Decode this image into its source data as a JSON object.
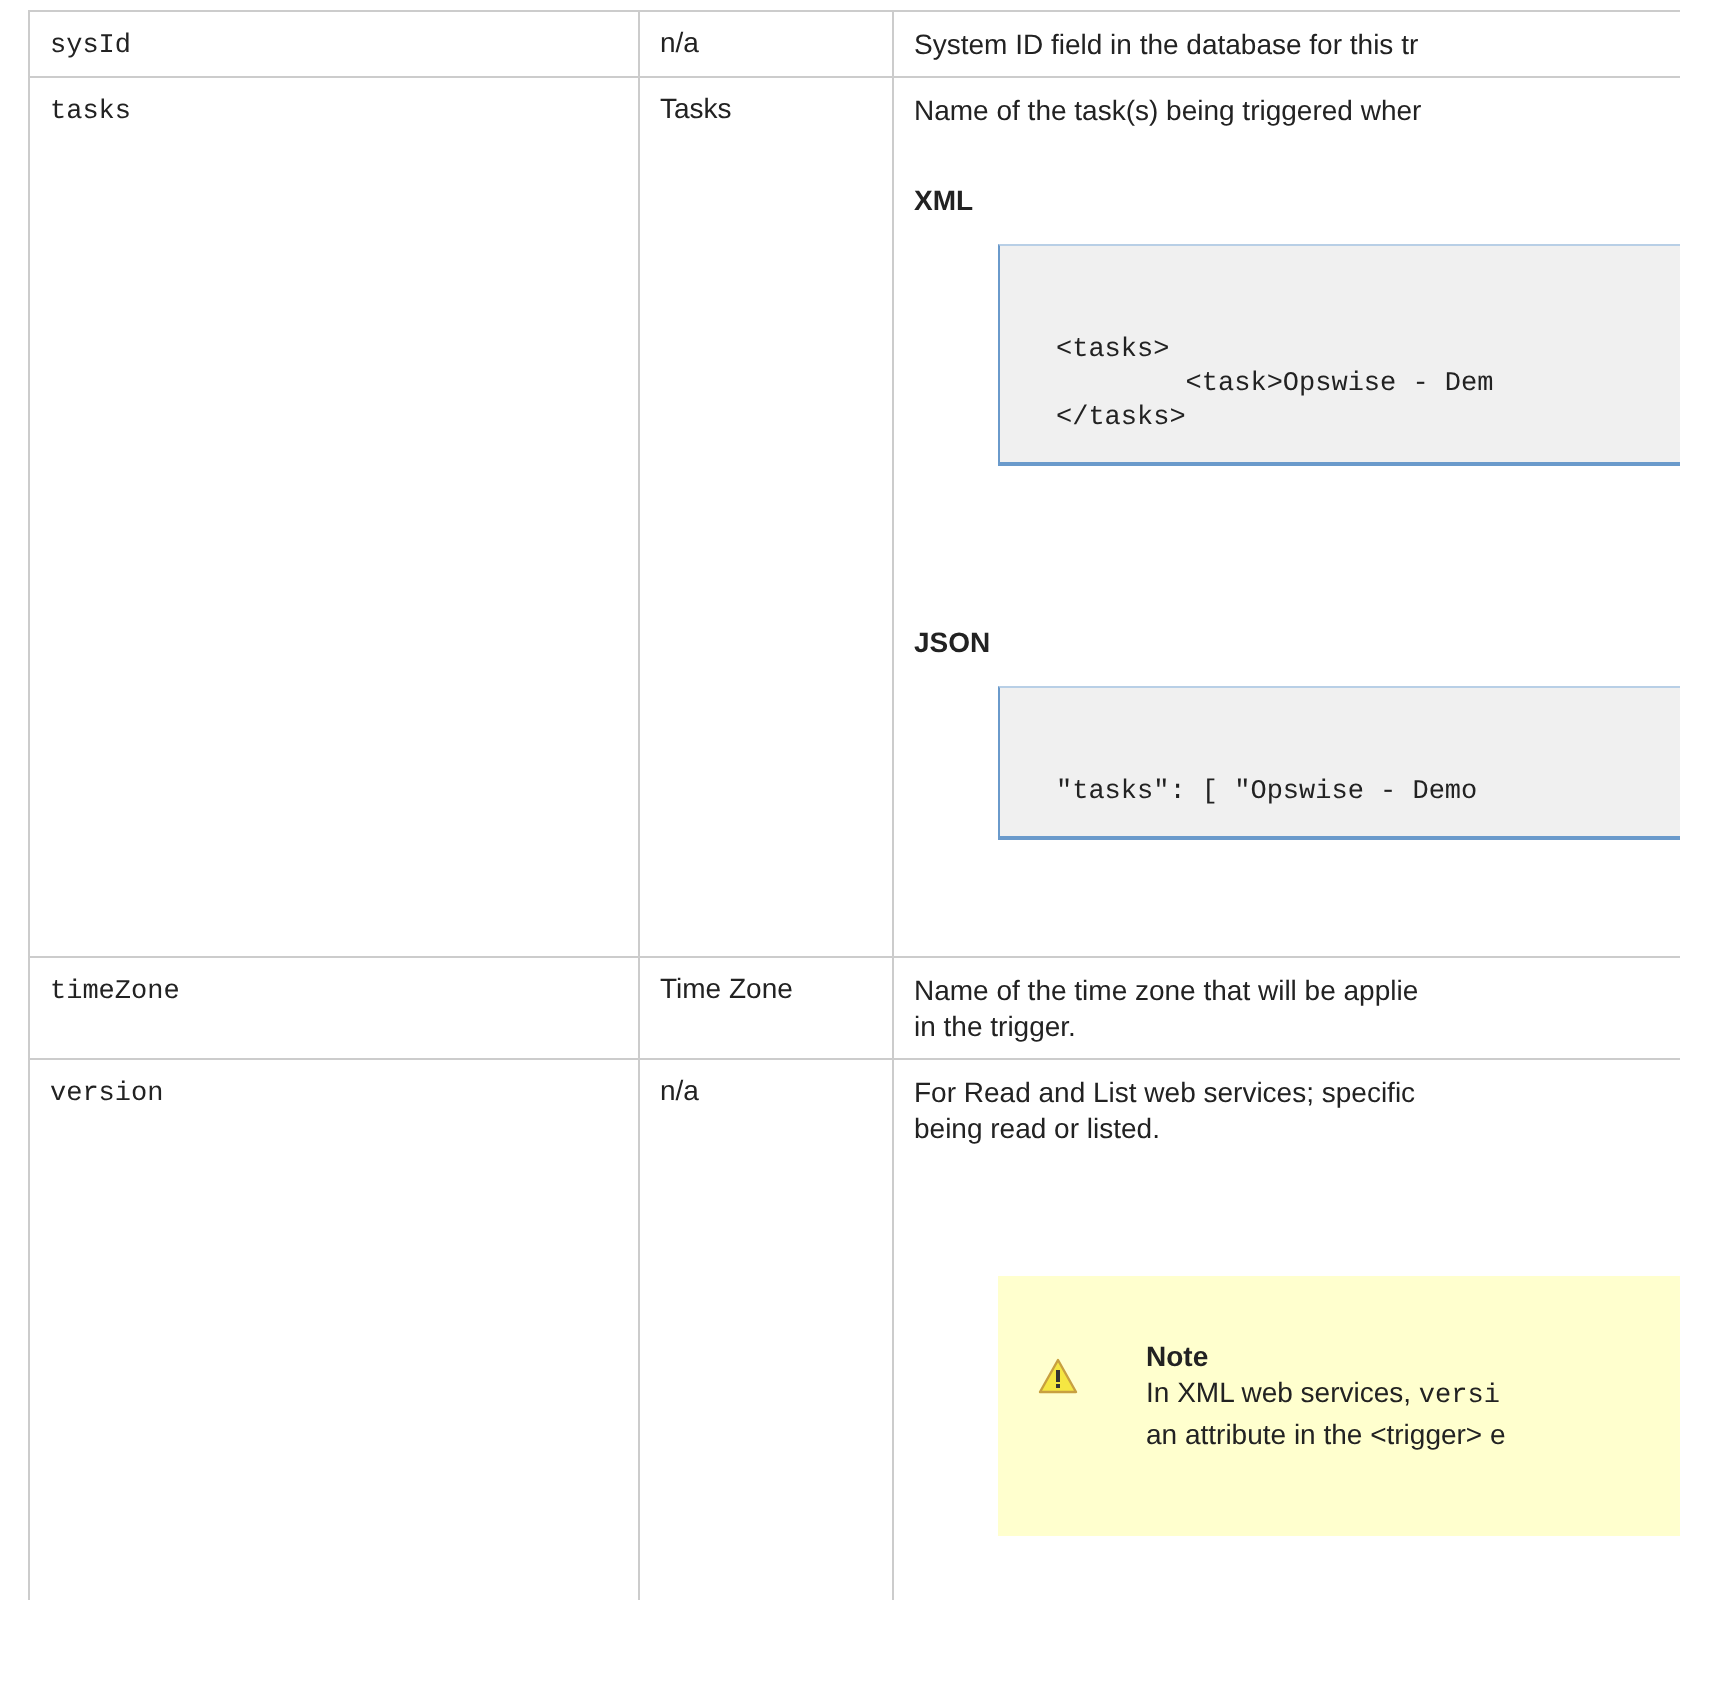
{
  "rows": [
    {
      "name": "sysId",
      "label": "n/a",
      "blocks": [
        {
          "kind": "text",
          "lines": [
            "System ID field in the database for this tr"
          ]
        }
      ]
    },
    {
      "name": "tasks",
      "label": "Tasks",
      "blocks": [
        {
          "kind": "text",
          "lines": [
            "Name of the task(s) being triggered wher"
          ]
        },
        {
          "kind": "heading",
          "text": "XML"
        },
        {
          "kind": "code",
          "lines": [
            "<tasks>",
            "        <task>Opswise - Dem",
            "</tasks>"
          ]
        },
        {
          "kind": "heading",
          "text": "JSON"
        },
        {
          "kind": "code",
          "lines": [
            "\"tasks\": [ \"Opswise - Demo"
          ]
        }
      ]
    },
    {
      "name": "timeZone",
      "label": "Time Zone",
      "blocks": [
        {
          "kind": "text",
          "lines": [
            "Name of the time zone that will be applie",
            "in the trigger."
          ]
        }
      ]
    },
    {
      "name": "version",
      "label": "n/a",
      "blocks": [
        {
          "kind": "text",
          "lines": [
            "For Read and List web services; specific",
            "being read or listed."
          ]
        },
        {
          "kind": "note",
          "title": "Note",
          "lines": [
            [
              {
                "kind": "text",
                "text": "In XML web services, "
              },
              {
                "kind": "code",
                "text": "versi"
              }
            ],
            [
              {
                "kind": "text",
                "text": "an attribute in the <trigger> e"
              }
            ]
          ]
        }
      ]
    }
  ]
}
